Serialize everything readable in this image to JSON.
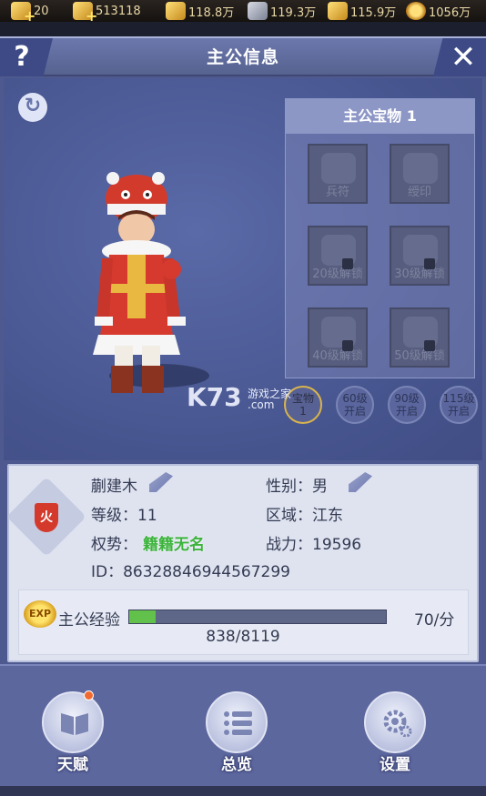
{
  "resources": [
    {
      "icon": "ingot-icon",
      "value": "20"
    },
    {
      "icon": "gold-icon",
      "value": "513118"
    },
    {
      "icon": "wood-icon",
      "value": "118.8万"
    },
    {
      "icon": "iron-icon",
      "value": "119.3万"
    },
    {
      "icon": "grain-icon",
      "value": "115.9万"
    },
    {
      "icon": "coin-icon",
      "value": "1056万"
    }
  ],
  "header": {
    "title": "主公信息",
    "help": "?",
    "close": "✕"
  },
  "treasure": {
    "title": "主公宝物 1",
    "slots": [
      {
        "label": "兵符",
        "locked": false
      },
      {
        "label": "绶印",
        "locked": false
      },
      {
        "label": "20级解锁",
        "locked": true
      },
      {
        "label": "30级解锁",
        "locked": true
      },
      {
        "label": "40级解锁",
        "locked": true
      },
      {
        "label": "50级解锁",
        "locked": true
      }
    ]
  },
  "treasure_tabs": [
    {
      "line1": "宝物",
      "line2": "1",
      "active": true
    },
    {
      "line1": "60级",
      "line2": "开启",
      "active": false
    },
    {
      "line1": "90级",
      "line2": "开启",
      "active": false
    },
    {
      "line1": "115级",
      "line2": "开启",
      "active": false
    }
  ],
  "watermark": {
    "main": "K73",
    "sub1": "游戏之家",
    "sub2": ".com"
  },
  "info": {
    "name": "蒯建木",
    "gender": "性别：男",
    "level": "等级：11",
    "region": "区域：江东",
    "power_label": "权势：",
    "power_value": "籍籍无名",
    "combat": "战力：19596",
    "id": "ID：86328846944567299",
    "element": "火"
  },
  "exp": {
    "icon_text": "EXP",
    "label": "主公经验",
    "rate": "70/分",
    "current": 838,
    "max": 8119,
    "text": "838/8119",
    "progress": 0.103
  },
  "bottom": [
    {
      "label": "天赋",
      "icon": "book-icon",
      "notify": true
    },
    {
      "label": "总览",
      "icon": "list-icon",
      "notify": false
    },
    {
      "label": "设置",
      "icon": "gear-icon",
      "notify": false
    }
  ]
}
